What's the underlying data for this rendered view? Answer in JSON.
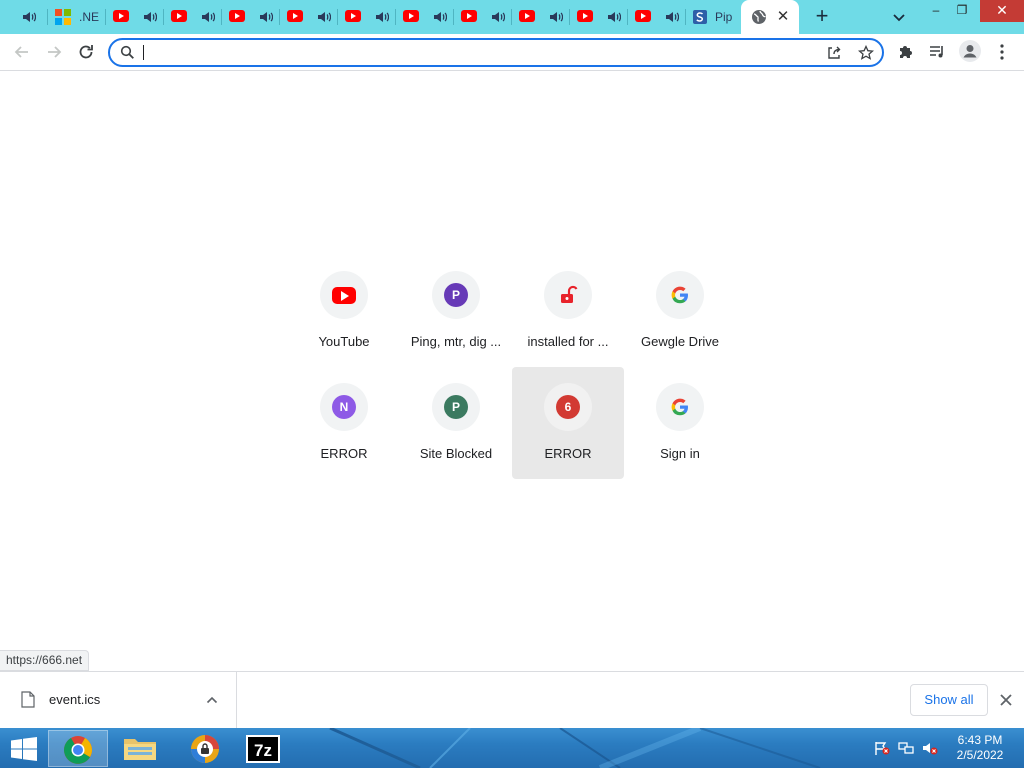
{
  "tabs": {
    "ms_tab_title": ".NE",
    "last_tab_title": "Pip",
    "new_tab_label": "+"
  },
  "window": {
    "minimize": "–",
    "restore": "❐",
    "close": "✕"
  },
  "omnibox": {
    "value": "",
    "placeholder": ""
  },
  "shortcuts": [
    {
      "label": "YouTube",
      "icon": "youtube-icon"
    },
    {
      "label": "Ping, mtr, dig ...",
      "letter": "P",
      "color": "#673ab7"
    },
    {
      "label": "installed for ...",
      "icon": "unlocked-padlock-icon"
    },
    {
      "label": "Gewgle Drive",
      "icon": "google-g-icon"
    },
    {
      "label": "ERROR",
      "letter": "N",
      "color": "#8e5ae6"
    },
    {
      "label": "Site Blocked",
      "letter": "P",
      "color": "#3b7a60"
    },
    {
      "label": "ERROR",
      "letter": "6",
      "color": "#d23a33"
    },
    {
      "label": "Sign in",
      "icon": "google-g-icon"
    }
  ],
  "status_bubble": "https://666.net",
  "downloads": {
    "file_name": "event.ics",
    "show_all": "Show all"
  },
  "taskbar": {
    "time": "6:43 PM",
    "date": "2/5/2022"
  },
  "colors": {
    "tabstrip": "#6fdbe7",
    "accent": "#1a73e8",
    "youtube_red": "#ff0000"
  }
}
